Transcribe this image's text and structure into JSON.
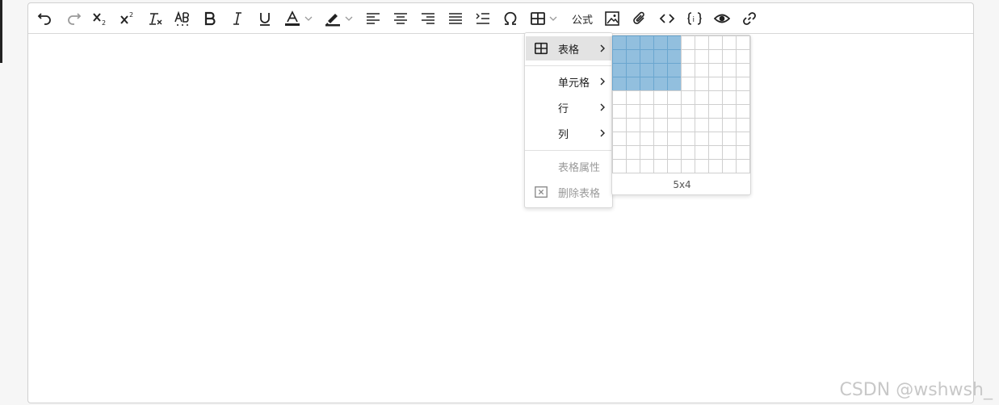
{
  "toolbar": {
    "formula_label": "公式"
  },
  "table_menu": {
    "items": [
      {
        "label": "表格",
        "has_submenu": true,
        "active": true,
        "icon": "table-icon"
      },
      {
        "label": "单元格",
        "has_submenu": true
      },
      {
        "label": "行",
        "has_submenu": true
      },
      {
        "label": "列",
        "has_submenu": true
      },
      {
        "label": "表格属性",
        "disabled": true
      },
      {
        "label": "删除表格",
        "disabled": true,
        "icon": "delete-box-icon"
      }
    ]
  },
  "table_grid": {
    "columns": 10,
    "rows": 10,
    "selected_cols": 5,
    "selected_rows": 4,
    "size_label": "5x4",
    "highlight_color": "#92bfde"
  },
  "watermark": "CSDN @wshwsh_"
}
